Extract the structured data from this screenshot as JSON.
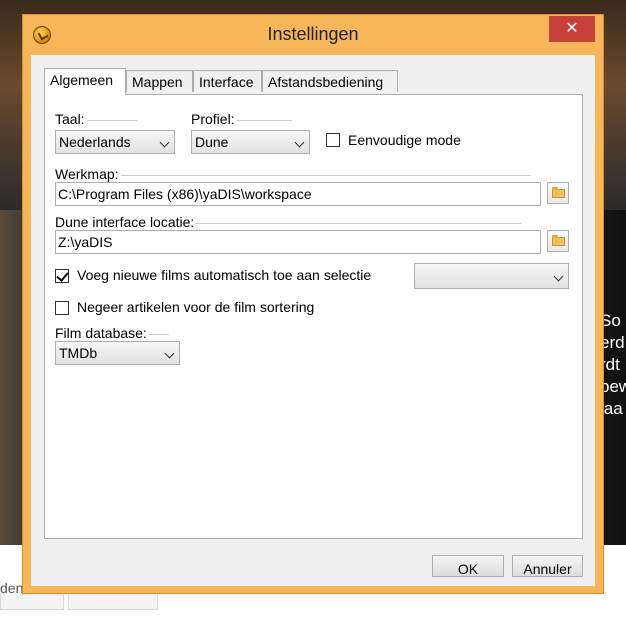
{
  "window": {
    "title": "Instellingen",
    "close_glyph": "✕"
  },
  "tabs": [
    {
      "label": "Algemeen",
      "active": true
    },
    {
      "label": "Mappen",
      "active": false
    },
    {
      "label": "Interface",
      "active": false
    },
    {
      "label": "Afstandsbediening",
      "active": false
    }
  ],
  "general": {
    "language_label": "Taal:",
    "language_value": "Nederlands",
    "profile_label": "Profiel:",
    "profile_value": "Dune",
    "simple_mode_label": "Eenvoudige mode",
    "simple_mode_checked": false,
    "workdir_label": "Werkmap:",
    "workdir_value": "C:\\Program Files (x86)\\yaDIS\\workspace",
    "dune_location_label": "Dune interface locatie:",
    "dune_location_value": "Z:\\yaDIS",
    "auto_add_label": "Voeg nieuwe films automatisch toe aan selectie",
    "auto_add_checked": true,
    "auto_add_select_value": "",
    "ignore_articles_label": "Negeer artikelen voor de film sortering",
    "ignore_articles_checked": false,
    "film_db_label": "Film database:",
    "film_db_value": "TMDb"
  },
  "buttons": {
    "ok": "OK",
    "cancel": "Annuler"
  },
  "background": {
    "right_text": [
      "So",
      "erd",
      "rdt",
      "pew",
      "laa"
    ],
    "left_text": "den"
  },
  "colors": {
    "window_frame": "#f7b65a",
    "close_button": "#c7413b"
  }
}
